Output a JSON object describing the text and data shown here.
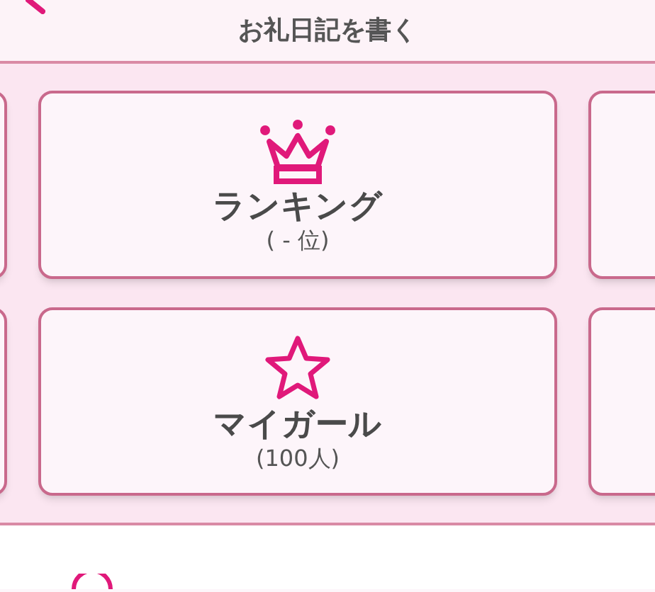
{
  "header": {
    "title": "お礼日記を書く"
  },
  "menu": [
    {
      "kind": "ranking",
      "label": "ランキング",
      "sub": "( - 位)"
    },
    {
      "kind": "favorites",
      "label": "マイガール",
      "sub": "(100人)"
    }
  ]
}
